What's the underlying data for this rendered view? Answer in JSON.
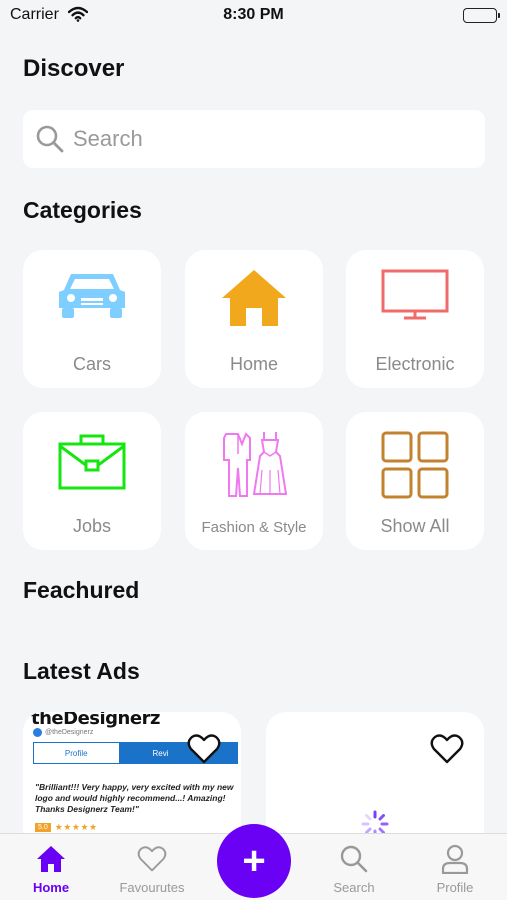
{
  "status_bar": {
    "carrier": "Carrier",
    "time": "8:30 PM"
  },
  "header": {
    "title": "Discover"
  },
  "search": {
    "placeholder": "Search"
  },
  "categories": {
    "title": "Categories",
    "items": [
      {
        "label": "Cars",
        "icon": "car-icon",
        "color": "#7ecfff"
      },
      {
        "label": "Home",
        "icon": "house-icon",
        "color": "#f2a81d"
      },
      {
        "label": "Electronic",
        "icon": "tv-icon",
        "color": "#f26b6b"
      },
      {
        "label": "Jobs",
        "icon": "briefcase-icon",
        "color": "#16e60f"
      },
      {
        "label": "Fashion & Style",
        "icon": "clothing-icon",
        "color": "#f078f0"
      },
      {
        "label": "Show All",
        "icon": "grid-icon",
        "color": "#c2822e"
      }
    ]
  },
  "featured": {
    "title": "Feachured"
  },
  "latest_ads": {
    "title": "Latest Ads",
    "ads": [
      {
        "thumbnail": {
          "brand": "theDesignerz",
          "handle": "@theDesignerz",
          "tab_profile": "Profile",
          "tab_reviews": "Revi",
          "quote": "\"Brilliant!!! Very happy, very excited with my new logo and would highly recommend...! Amazing! Thanks Designerz Team!\"",
          "score": "5.0",
          "stars": "★★★★★"
        }
      },
      {
        "loading": true
      }
    ]
  },
  "tab_bar": {
    "items": [
      {
        "label": "Home",
        "icon": "home-icon",
        "active": true
      },
      {
        "label": "Favourutes",
        "icon": "heart-icon"
      },
      {
        "label": "Search",
        "icon": "search-icon"
      },
      {
        "label": "Profile",
        "icon": "profile-icon"
      }
    ],
    "fab_icon": "plus-icon",
    "fab_label": "+"
  },
  "colors": {
    "accent": "#6a00f4",
    "background": "#f4f5f7"
  }
}
